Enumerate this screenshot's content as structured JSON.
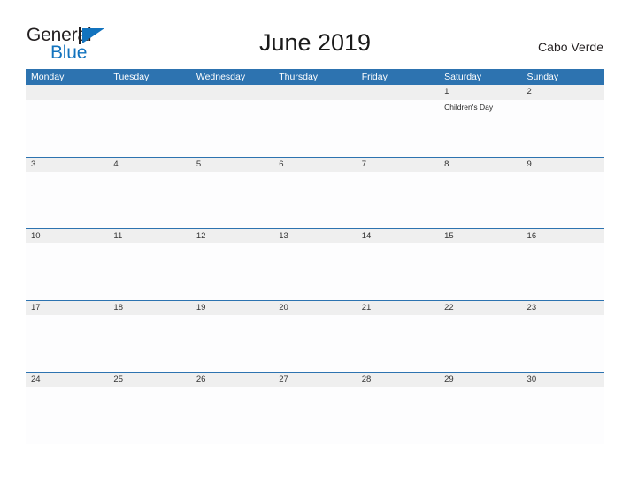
{
  "header": {
    "logo": {
      "word_one": "General",
      "word_two": "Blue",
      "mark": "flag-triangle-icon",
      "dark_color": "#231f20",
      "blue_color": "#1273be"
    },
    "title": "June 2019",
    "country": "Cabo Verde"
  },
  "theme": {
    "header_blue": "#2d73b0",
    "date_band_gray": "#efefef",
    "cell_background": "#fdfdfe",
    "page_background": "#ffffff",
    "date_text": "#333333",
    "event_text": "#262626"
  },
  "calendar": {
    "month": "June",
    "year": "2019",
    "day_headers": [
      "Monday",
      "Tuesday",
      "Wednesday",
      "Thursday",
      "Friday",
      "Saturday",
      "Sunday"
    ],
    "weeks": [
      {
        "days": [
          {
            "number": "",
            "events": []
          },
          {
            "number": "",
            "events": []
          },
          {
            "number": "",
            "events": []
          },
          {
            "number": "",
            "events": []
          },
          {
            "number": "",
            "events": []
          },
          {
            "number": "1",
            "events": [
              "Children's Day"
            ]
          },
          {
            "number": "2",
            "events": []
          }
        ]
      },
      {
        "days": [
          {
            "number": "3",
            "events": []
          },
          {
            "number": "4",
            "events": []
          },
          {
            "number": "5",
            "events": []
          },
          {
            "number": "6",
            "events": []
          },
          {
            "number": "7",
            "events": []
          },
          {
            "number": "8",
            "events": []
          },
          {
            "number": "9",
            "events": []
          }
        ]
      },
      {
        "days": [
          {
            "number": "10",
            "events": []
          },
          {
            "number": "11",
            "events": []
          },
          {
            "number": "12",
            "events": []
          },
          {
            "number": "13",
            "events": []
          },
          {
            "number": "14",
            "events": []
          },
          {
            "number": "15",
            "events": []
          },
          {
            "number": "16",
            "events": []
          }
        ]
      },
      {
        "days": [
          {
            "number": "17",
            "events": []
          },
          {
            "number": "18",
            "events": []
          },
          {
            "number": "19",
            "events": []
          },
          {
            "number": "20",
            "events": []
          },
          {
            "number": "21",
            "events": []
          },
          {
            "number": "22",
            "events": []
          },
          {
            "number": "23",
            "events": []
          }
        ]
      },
      {
        "days": [
          {
            "number": "24",
            "events": []
          },
          {
            "number": "25",
            "events": []
          },
          {
            "number": "26",
            "events": []
          },
          {
            "number": "27",
            "events": []
          },
          {
            "number": "28",
            "events": []
          },
          {
            "number": "29",
            "events": []
          },
          {
            "number": "30",
            "events": []
          }
        ]
      }
    ]
  }
}
